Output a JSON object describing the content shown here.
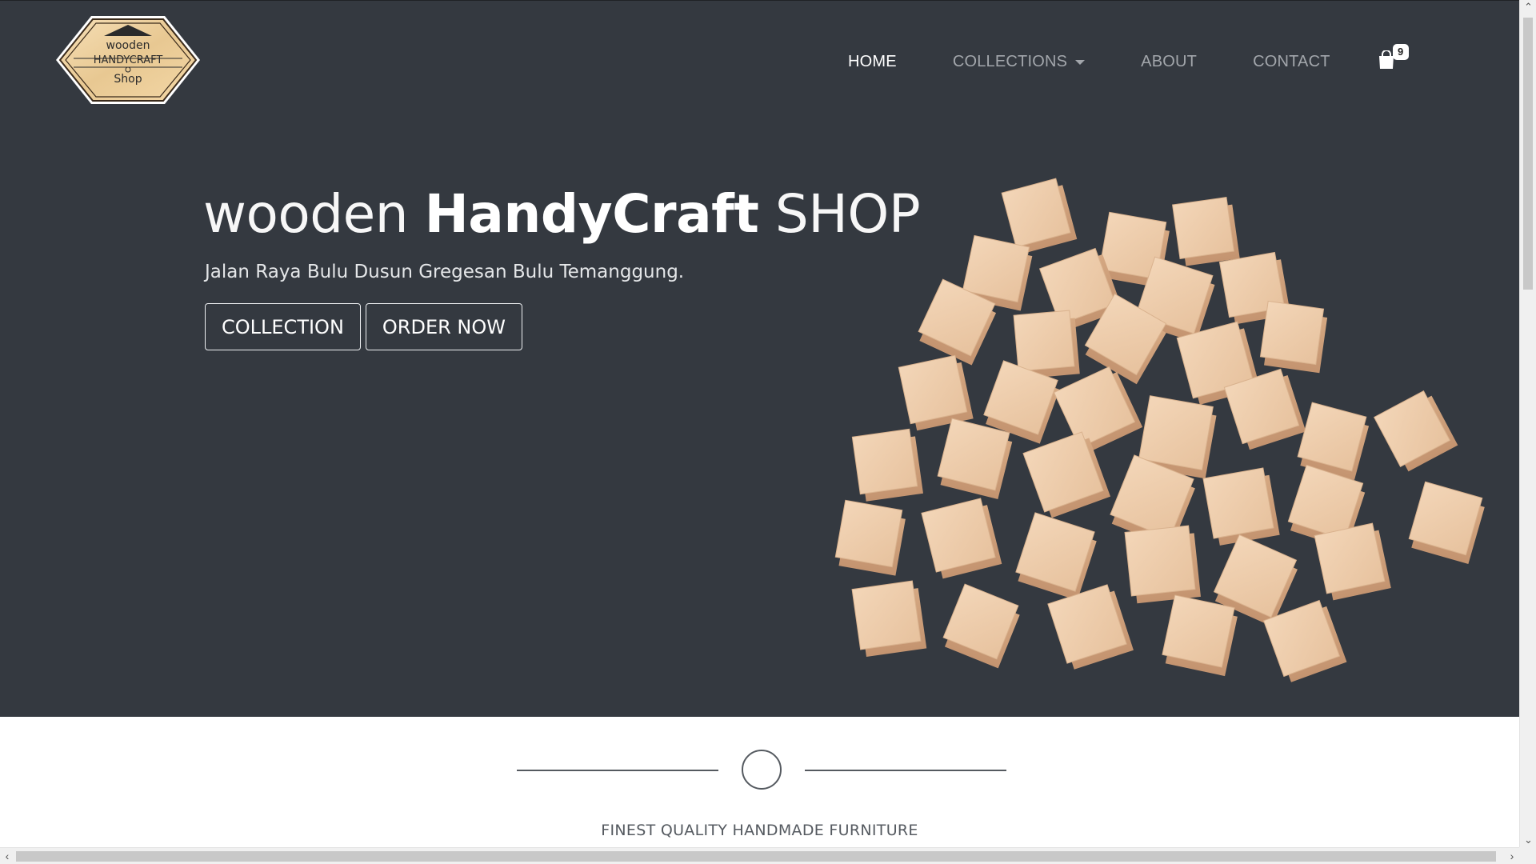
{
  "logo": {
    "line1": "wooden",
    "line2": "HANDYCRAFT",
    "line3": "Shop"
  },
  "nav": {
    "items": [
      {
        "label": "HOME",
        "active": true
      },
      {
        "label": "COLLECTIONS",
        "dropdown": true
      },
      {
        "label": "ABOUT"
      },
      {
        "label": "CONTACT"
      }
    ],
    "cart_icon": "shopping-bag-icon",
    "cart_count": "9"
  },
  "hero": {
    "title_part1": "wooden ",
    "title_part2": "HandyCraft",
    "title_part3": " SHOP",
    "address": "Jalan Raya Bulu Dusun Gregesan Bulu Temanggung.",
    "buttons": {
      "collection": "COLLECTION",
      "order": "ORDER NOW"
    }
  },
  "section": {
    "divider_icon": "circle-ring-icon",
    "tagline": "FINEST QUALITY HANDMADE FURNITURE"
  },
  "colors": {
    "hero_bg": "#343940",
    "nav_inactive": "#a2a6ab",
    "nav_active": "#ffffff",
    "wood": "#eac8a6"
  }
}
